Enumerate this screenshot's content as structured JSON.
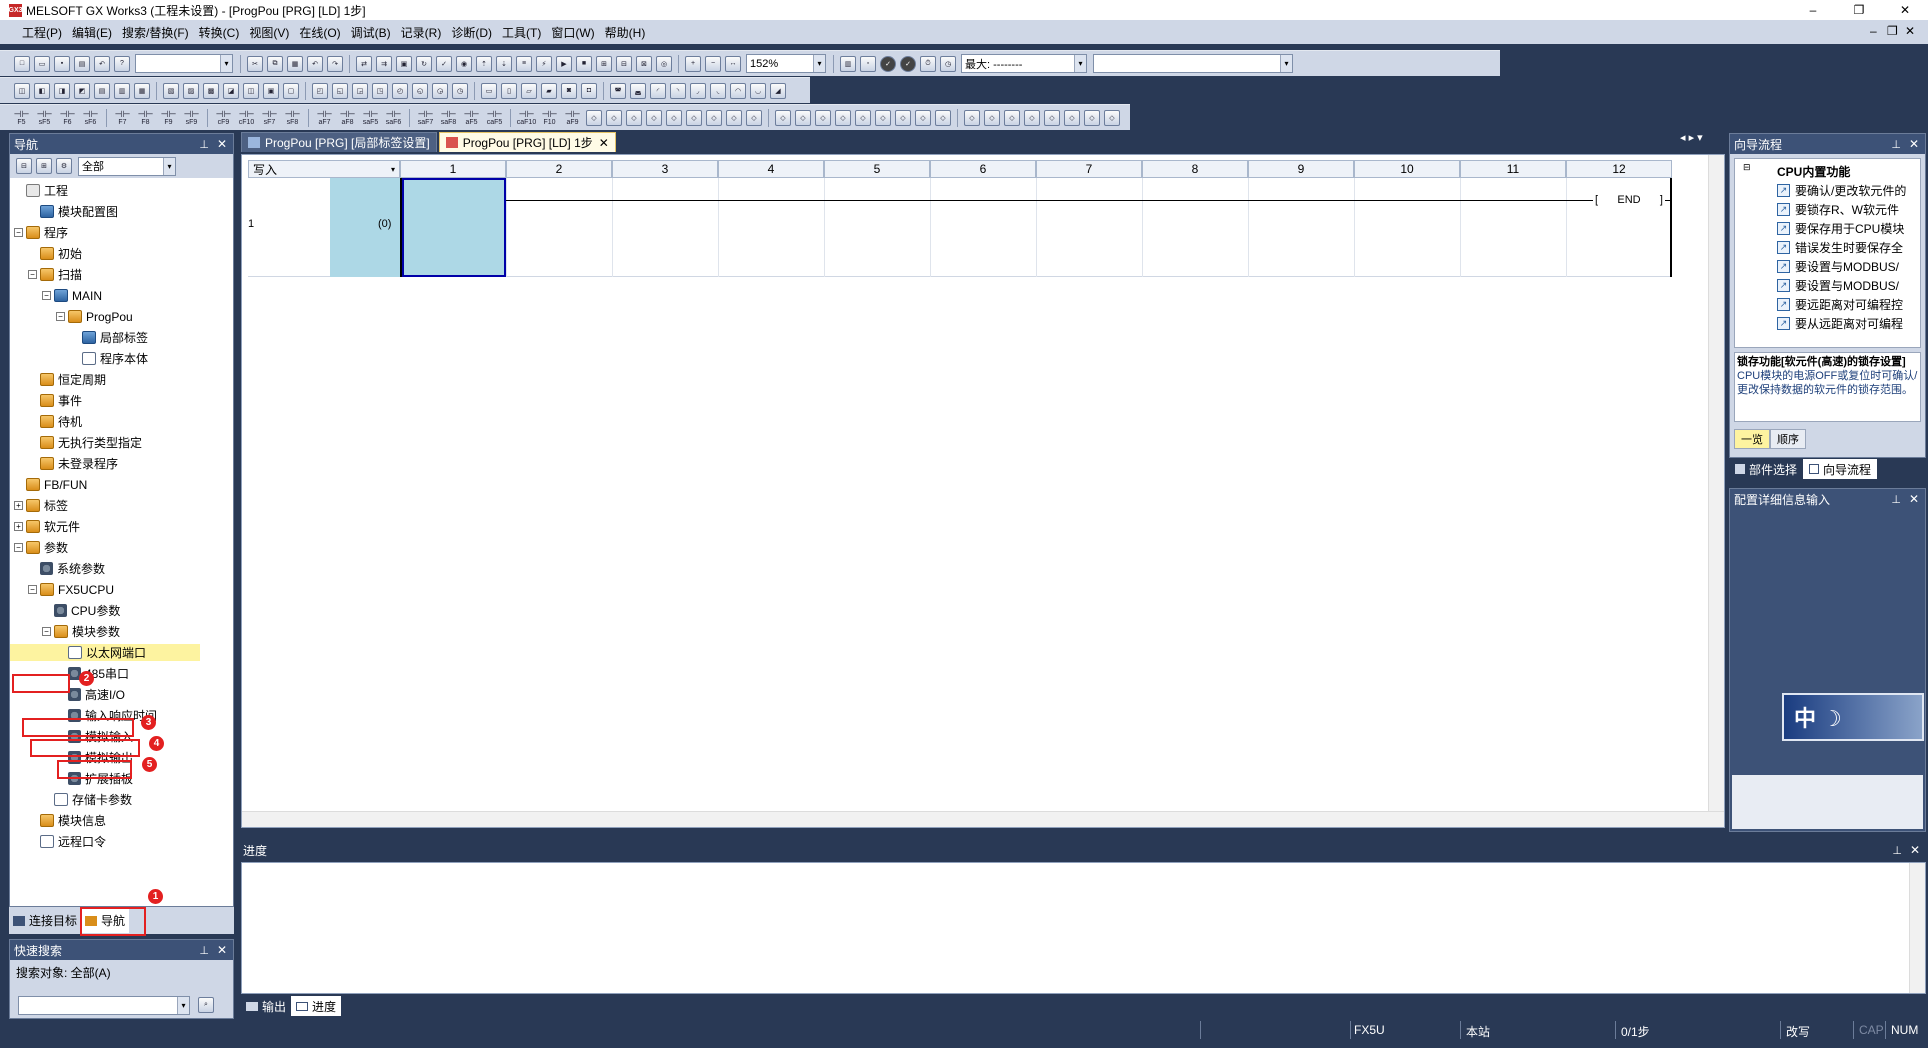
{
  "window": {
    "icon_text": "GX3",
    "title": "MELSOFT GX Works3 (工程未设置) - [ProgPou [PRG] [LD] 1步]",
    "minimize": "–",
    "restore": "❐",
    "close": "✕",
    "mdi_minimize": "–",
    "mdi_restore": "❐",
    "mdi_close": "✕"
  },
  "menu": [
    "工程(P)",
    "编辑(E)",
    "搜索/替换(F)",
    "转换(C)",
    "视图(V)",
    "在线(O)",
    "调试(B)",
    "记录(R)",
    "诊断(D)",
    "工具(T)",
    "窗口(W)",
    "帮助(H)"
  ],
  "toolbar": {
    "zoom_value": "152%",
    "max_label": "最大: --------",
    "function_keys": [
      "F5",
      "sF5",
      "F6",
      "sF6",
      "F7",
      "F8",
      "F9",
      "sF9",
      "cF9",
      "cF10",
      "sF7",
      "sF8",
      "aF7",
      "aF8",
      "saF5",
      "saF6",
      "saF7",
      "saF8",
      "aF5",
      "caF5",
      "caF10",
      "F10",
      "aF9"
    ]
  },
  "navigation": {
    "title": "导航",
    "filter_value": "全部",
    "pin": "⊥",
    "close": "✕",
    "tree": [
      {
        "label": "工程",
        "level": 0,
        "expander": "",
        "icon": "project-icon"
      },
      {
        "label": "模块配置图",
        "level": 1,
        "expander": "",
        "icon": "module-config-icon"
      },
      {
        "label": "程序",
        "level": 0,
        "expander": "−",
        "icon": "folder-icon"
      },
      {
        "label": "初始",
        "level": 1,
        "expander": "",
        "icon": "folder-icon"
      },
      {
        "label": "扫描",
        "level": 1,
        "expander": "−",
        "icon": "folder-icon"
      },
      {
        "label": "MAIN",
        "level": 2,
        "expander": "−",
        "icon": "program-file-icon"
      },
      {
        "label": "ProgPou",
        "level": 3,
        "expander": "−",
        "icon": "pou-icon"
      },
      {
        "label": "局部标签",
        "level": 4,
        "expander": "",
        "icon": "label-icon"
      },
      {
        "label": "程序本体",
        "level": 4,
        "expander": "",
        "icon": "program-body-icon"
      },
      {
        "label": "恒定周期",
        "level": 1,
        "expander": "",
        "icon": "folder-icon"
      },
      {
        "label": "事件",
        "level": 1,
        "expander": "",
        "icon": "folder-icon"
      },
      {
        "label": "待机",
        "level": 1,
        "expander": "",
        "icon": "folder-icon"
      },
      {
        "label": "无执行类型指定",
        "level": 1,
        "expander": "",
        "icon": "folder-icon"
      },
      {
        "label": "未登录程序",
        "level": 1,
        "expander": "",
        "icon": "folder-icon"
      },
      {
        "label": "FB/FUN",
        "level": 0,
        "expander": "",
        "icon": "fbfun-icon"
      },
      {
        "label": "标签",
        "level": 0,
        "expander": "+",
        "icon": "folder-icon"
      },
      {
        "label": "软元件",
        "level": 0,
        "expander": "+",
        "icon": "folder-icon"
      },
      {
        "label": "参数",
        "level": 0,
        "expander": "−",
        "icon": "parameter-icon"
      },
      {
        "label": "系统参数",
        "level": 1,
        "expander": "",
        "icon": "gear-icon"
      },
      {
        "label": "FX5UCPU",
        "level": 1,
        "expander": "−",
        "icon": "parameter-icon"
      },
      {
        "label": "CPU参数",
        "level": 2,
        "expander": "",
        "icon": "gear-icon"
      },
      {
        "label": "模块参数",
        "level": 2,
        "expander": "−",
        "icon": "parameter-icon"
      },
      {
        "label": "以太网端口",
        "level": 3,
        "expander": "",
        "icon": "ethernet-icon"
      },
      {
        "label": "485串口",
        "level": 3,
        "expander": "",
        "icon": "gear-icon"
      },
      {
        "label": "高速I/O",
        "level": 3,
        "expander": "",
        "icon": "gear-icon"
      },
      {
        "label": "输入响应时间",
        "level": 3,
        "expander": "",
        "icon": "gear-icon"
      },
      {
        "label": "模拟输入",
        "level": 3,
        "expander": "",
        "icon": "gear-icon"
      },
      {
        "label": "模拟输出",
        "level": 3,
        "expander": "",
        "icon": "gear-icon"
      },
      {
        "label": "扩展插板",
        "level": 3,
        "expander": "",
        "icon": "gear-icon"
      },
      {
        "label": "存储卡参数",
        "level": 2,
        "expander": "",
        "icon": "memory-card-icon"
      },
      {
        "label": "模块信息",
        "level": 1,
        "expander": "",
        "icon": "folder-icon"
      },
      {
        "label": "远程口令",
        "level": 1,
        "expander": "",
        "icon": "lock-icon"
      }
    ],
    "tabs": [
      "连接目标",
      "导航"
    ],
    "annotations": [
      "1",
      "2",
      "3",
      "4",
      "5"
    ]
  },
  "quick_search": {
    "title": "快速搜索",
    "target_label": "搜索对象: 全部(A)",
    "input_value": ""
  },
  "editor": {
    "tabs": [
      "ProgPou [PRG] [局部标签设置]",
      "ProgPou [PRG] [LD] 1步"
    ],
    "header_mode": "写入",
    "columns": [
      "1",
      "2",
      "3",
      "4",
      "5",
      "6",
      "7",
      "8",
      "9",
      "10",
      "11",
      "12"
    ],
    "row_number": "1",
    "step_number": "(0)",
    "end_label": "END"
  },
  "guide_flow": {
    "title": "向导流程",
    "group": "CPU内置功能",
    "items": [
      "要确认/更改软元件的",
      "要锁存R、W软元件",
      "要保存用于CPU模块",
      "错误发生时要保存全",
      "要设置与MODBUS/",
      "要设置与MODBUS/",
      "要远距离对可编程控",
      "要从远距离对可编程"
    ],
    "selected_title": "锁存功能[软元件(高速)的锁存设置]",
    "description": "CPU模块的电源OFF或复位时可确认/更改保持数据的软元件的锁存范围。",
    "subtabs": [
      "一览",
      "顺序"
    ],
    "bottom_tabs": [
      "部件选择",
      "向导流程"
    ]
  },
  "config_detail": {
    "title": "配置详细信息输入",
    "banner_text": "中 ☽"
  },
  "progress_panel": {
    "title": "进度",
    "tabs": [
      "输出",
      "进度"
    ]
  },
  "status": {
    "cpu": "FX5U",
    "station": "本站",
    "steps": "0/1步",
    "mode": "改写",
    "cap": "CAP",
    "num": "NUM"
  },
  "colors": {
    "frame": "#293955",
    "panel_header": "#3d5277",
    "toolbar": "#cfd7e6",
    "highlight": "#fdf3a0",
    "annotation": "#e32020",
    "cursor_cell": "#add8e6"
  }
}
